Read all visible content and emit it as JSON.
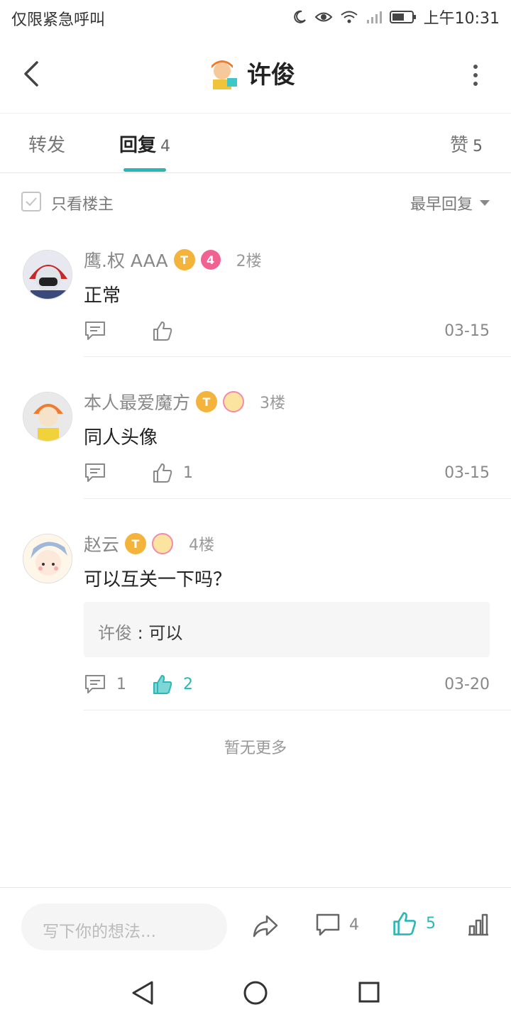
{
  "status_bar": {
    "left_text": "仅限紧急呼叫",
    "time": "上午10:31"
  },
  "header": {
    "title": "许俊",
    "back_icon": "chevron-left-icon",
    "more_icon": "more-vertical-icon"
  },
  "tabs": {
    "forward_label": "转发",
    "reply_label": "回复",
    "reply_count": "4",
    "like_label": "赞",
    "like_count": "5",
    "accent_color": "#2ab7b7"
  },
  "filter": {
    "only_op_label": "只看楼主",
    "sort_label": "最早回复"
  },
  "replies": [
    {
      "name": "鹰.权 AAA",
      "floor": "2楼",
      "content": "正常",
      "comment_count": "",
      "like_count": "",
      "date": "03-15",
      "badge_level": "4"
    },
    {
      "name": "本人最爱魔方",
      "floor": "3楼",
      "content": "同人头像",
      "comment_count": "",
      "like_count": "1",
      "date": "03-15"
    },
    {
      "name": "赵云",
      "floor": "4楼",
      "content": "可以互关一下吗？",
      "sub_reply_name": "许俊",
      "sub_reply_sep": " : ",
      "sub_reply_text": "可以",
      "comment_count": "1",
      "like_count": "2",
      "liked": true,
      "date": "03-20"
    }
  ],
  "no_more": "暂无更多",
  "bottom_bar": {
    "input_placeholder": "写下你的想法...",
    "comment_count": "4",
    "like_count": "5"
  }
}
